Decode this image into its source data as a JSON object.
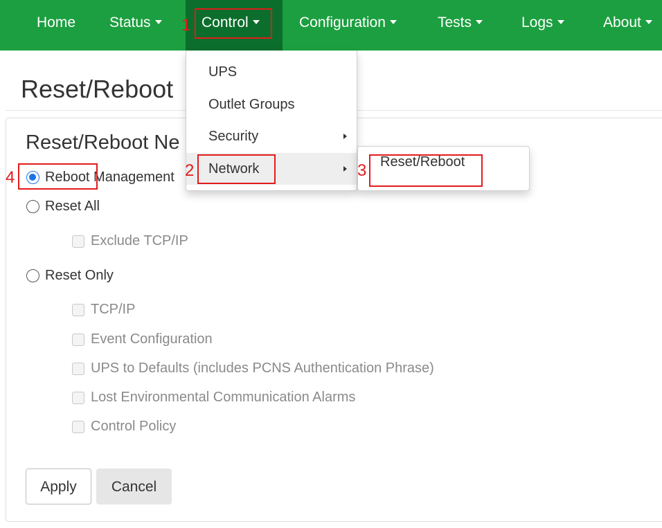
{
  "nav": {
    "items": [
      {
        "label": "Home",
        "dropdown": false
      },
      {
        "label": "Status",
        "dropdown": true
      },
      {
        "label": "Control",
        "dropdown": true,
        "active": true
      },
      {
        "label": "Configuration",
        "dropdown": true
      },
      {
        "label": "Tests",
        "dropdown": true
      },
      {
        "label": "Logs",
        "dropdown": true
      },
      {
        "label": "About",
        "dropdown": true
      }
    ],
    "bg_color": "#1c9f40",
    "active_color": "#0c6e2c"
  },
  "page": {
    "title": "Reset/Reboot"
  },
  "panel": {
    "title": "Reset/Reboot Ne",
    "options": [
      {
        "label": "Reboot Management",
        "checked": true
      },
      {
        "label": "Reset All",
        "checked": false
      },
      {
        "label": "Reset Only",
        "checked": false
      }
    ],
    "reset_all_checks": [
      "Exclude TCP/IP"
    ],
    "reset_only_checks": [
      "TCP/IP",
      "Event Configuration",
      "UPS to Defaults (includes PCNS Authentication Phrase)",
      "Lost Environmental Communication Alarms",
      "Control Policy"
    ],
    "apply_label": "Apply",
    "cancel_label": "Cancel"
  },
  "dropdown": {
    "items": [
      {
        "label": "UPS",
        "submenu": false
      },
      {
        "label": "Outlet Groups",
        "submenu": false
      },
      {
        "label": "Security",
        "submenu": true
      },
      {
        "label": "Network",
        "submenu": true,
        "hover": true
      }
    ],
    "submenu_items": [
      "Reset/Reboot"
    ]
  },
  "annotations": {
    "color": "#e21b1b",
    "steps": [
      "1",
      "2",
      "3",
      "4"
    ]
  }
}
